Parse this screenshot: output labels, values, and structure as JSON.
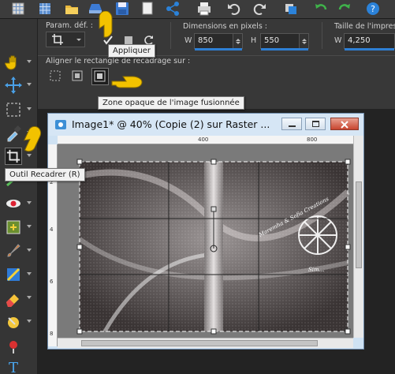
{
  "options": {
    "preset_label": "Param. déf. :",
    "dimensions_label": "Dimensions en pixels :",
    "w_label": "W",
    "w_value": "850",
    "h_label": "H",
    "h_value": "550",
    "print_label": "Taille de l'impression",
    "print_w_label": "W",
    "print_w_value": "4,250",
    "align_label": "Aligner le rectangle de recadrage sur :"
  },
  "tooltips": {
    "apply": "Appliquer",
    "opaque": "Zone opaque de l'image fusionnée",
    "crop_tool": "Outil Recadrer (R)"
  },
  "window": {
    "title": "Image1* @  40% (Copie (2) sur Raster ..."
  },
  "ruler": {
    "top_400": "400",
    "top_800": "800",
    "left_labels": [
      "2",
      "4",
      "6",
      "8"
    ]
  },
  "watermark": {
    "text_arc": "Maremha & Sofia Creations",
    "signature": "Sim..."
  },
  "colors": {
    "accent": "#2e7fd4",
    "tooltip_pointer": "#f2c200",
    "toolbar_bg": "#383838",
    "window_title_bg": "#d6e6f5"
  }
}
